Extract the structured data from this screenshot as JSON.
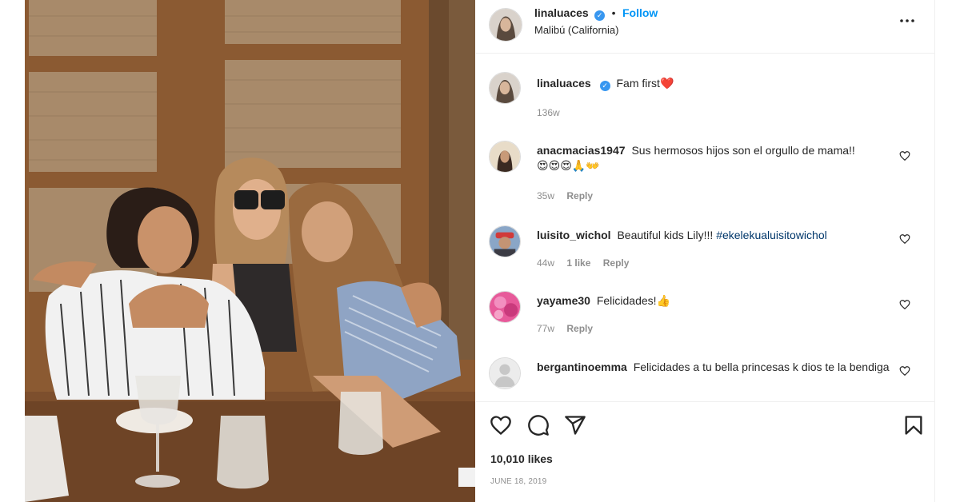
{
  "post": {
    "author": "linaluaces",
    "follow_label": "Follow",
    "separator": "•",
    "location": "Malibú (California)",
    "more_label": "•••",
    "caption_text": "Fam first",
    "caption_emoji": "❤️",
    "caption_age": "136w",
    "likes": "10,010 likes",
    "date": "JUNE 18, 2019"
  },
  "comments": [
    {
      "user": "anacmacias1947",
      "text": "Sus hermosos hijos son el orgullo de mama!!",
      "emoji": "😍😍😍🙏👐",
      "age": "35w",
      "likes": "",
      "reply": "Reply"
    },
    {
      "user": "luisito_wichol",
      "text": "Beautiful kids Lily!!!",
      "hashtag": "#ekelekualuisitowichol",
      "age": "44w",
      "likes": "1 like",
      "reply": "Reply"
    },
    {
      "user": "yayame30",
      "text": "Felicidades!",
      "emoji": "👍",
      "age": "77w",
      "likes": "",
      "reply": "Reply"
    },
    {
      "user": "bergantinoemma",
      "text": "Felicidades a tu bella princesas k dios te la bendiga",
      "age": "",
      "likes": "",
      "reply": ""
    }
  ],
  "icons": {
    "like": "heart-icon",
    "comment": "comment-icon",
    "share": "share-icon",
    "save": "bookmark-icon",
    "verified": "verified-badge-icon",
    "more": "more-options-icon",
    "comment_like": "heart-icon"
  },
  "colors": {
    "link_blue": "#0095f6",
    "hashtag_blue": "#00376b",
    "verified_blue": "#3897f0",
    "caption_heart": "#ed4956",
    "muted_text": "#8e8e8e",
    "primary_text": "#262626"
  }
}
